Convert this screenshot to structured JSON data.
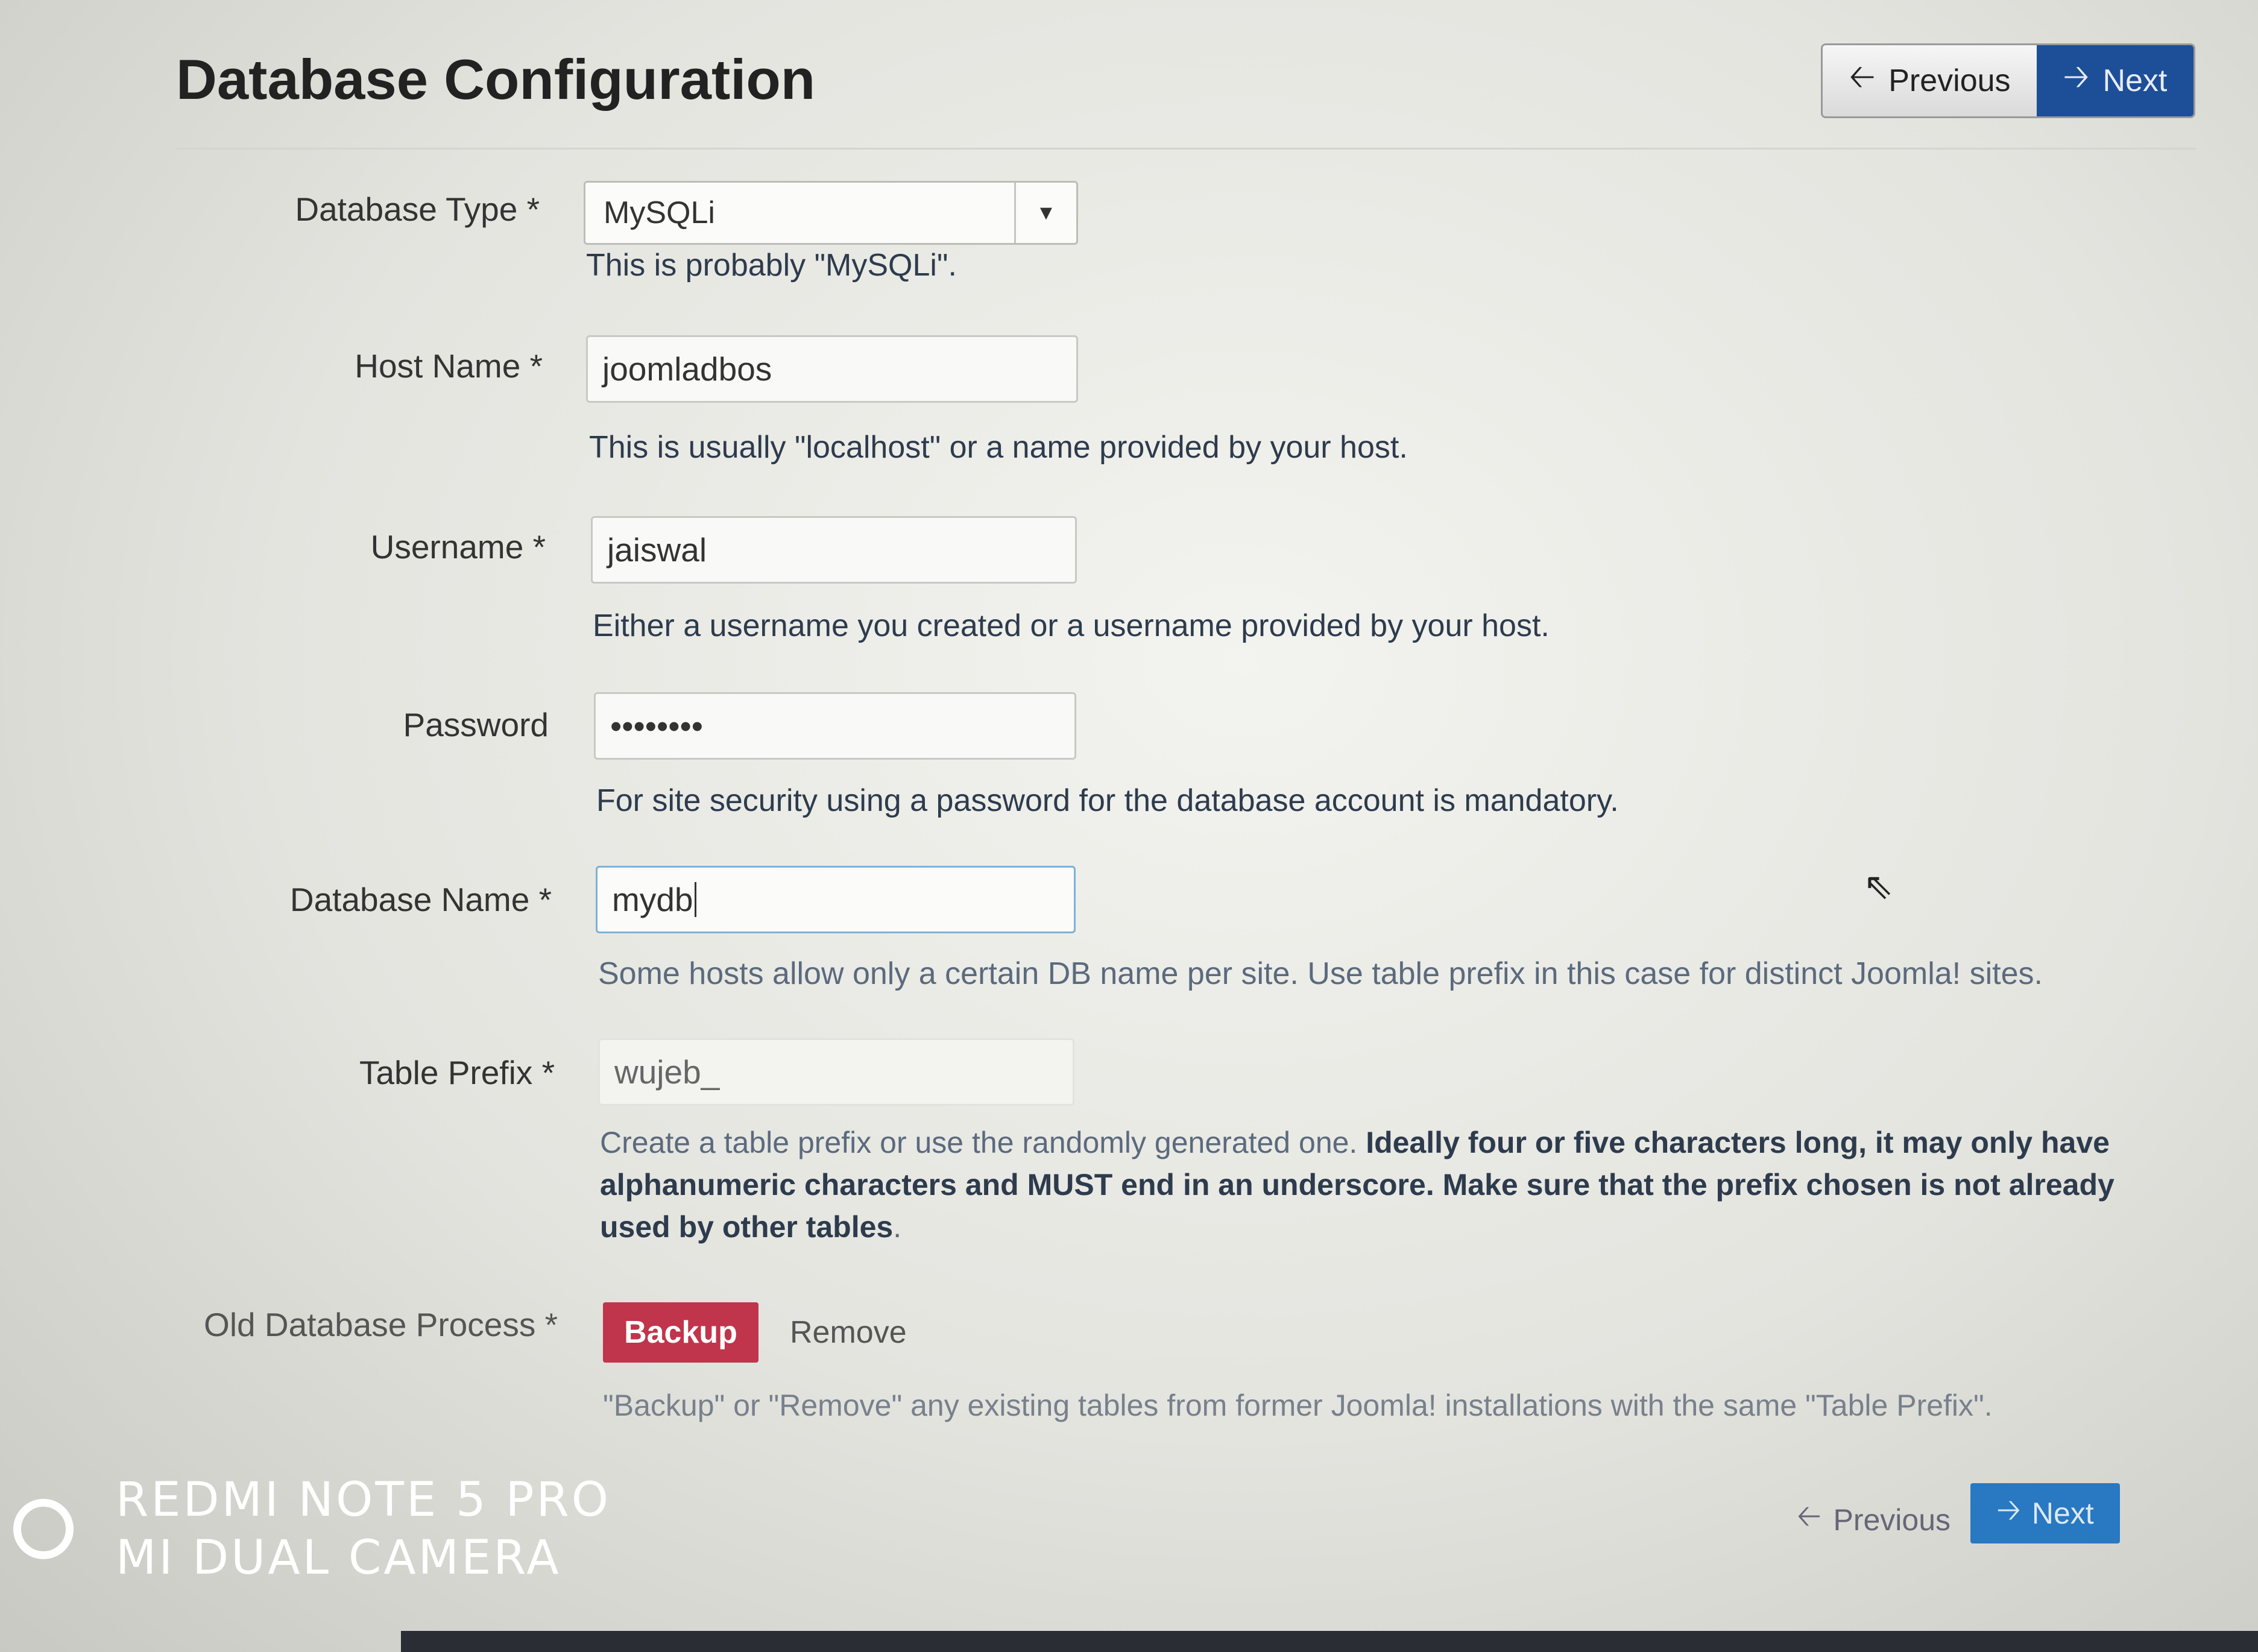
{
  "header": {
    "title": "Database Configuration",
    "previous_label": "Previous",
    "next_label": "Next"
  },
  "form": {
    "database_type": {
      "label": "Database Type *",
      "value": "MySQLi",
      "help": "This is probably \"MySQLi\"."
    },
    "host_name": {
      "label": "Host Name *",
      "value": "joomladbos",
      "help": "This is usually \"localhost\" or a name provided by your host."
    },
    "username": {
      "label": "Username *",
      "value": "jaiswal",
      "help": "Either a username you created or a username provided by your host."
    },
    "password": {
      "label": "Password",
      "value": "••••••••",
      "help": "For site security using a password for the database account is mandatory."
    },
    "database_name": {
      "label": "Database Name *",
      "value": "mydb",
      "help": "Some hosts allow only a certain DB name per site. Use table prefix in this case for distinct Joomla! sites."
    },
    "table_prefix": {
      "label": "Table Prefix *",
      "value": "wujeb_",
      "help_plain": "Create a table prefix or use the randomly generated one.",
      "help_bold": "Ideally four or five characters long, it may only have alphanumeric characters and MUST end in an underscore. Make sure that the prefix chosen is not already used by other tables",
      "help_end": "."
    },
    "old_database_process": {
      "label": "Old Database Process *",
      "backup_label": "Backup",
      "remove_label": "Remove",
      "help": "\"Backup\" or \"Remove\" any existing tables from former Joomla! installations with the same \"Table Prefix\"."
    }
  },
  "footer": {
    "previous_label": "Previous",
    "next_label": "Next"
  },
  "watermark": {
    "line1": "REDMI NOTE 5 PRO",
    "line2": "MI DUAL CAMERA"
  },
  "colors": {
    "primary": "#1d4e98",
    "danger": "#c0354b",
    "next_bottom": "#2878c2"
  }
}
